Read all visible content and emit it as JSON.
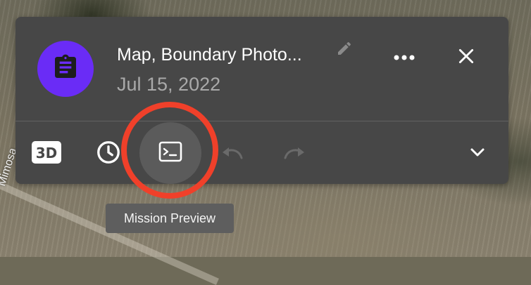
{
  "map": {
    "road_label": "Mimosa"
  },
  "header": {
    "title": "Map, Boundary Photo...",
    "date": "Jul 15, 2022"
  },
  "icons": {
    "avatar": "clipboard-icon",
    "edit": "pencil-icon",
    "more": "more-horizontal-icon",
    "close": "close-icon",
    "view_3d": "3d-view-icon",
    "history": "clock-icon",
    "mission_preview": "terminal-icon",
    "undo": "undo-icon",
    "redo": "redo-icon",
    "expand": "chevron-down-icon"
  },
  "tooltip": {
    "text": "Mission Preview"
  },
  "colors": {
    "panel": "#474747",
    "avatar": "#6a2cf6",
    "highlight": "#f0402a",
    "tooltip": "#5e5e5e"
  }
}
